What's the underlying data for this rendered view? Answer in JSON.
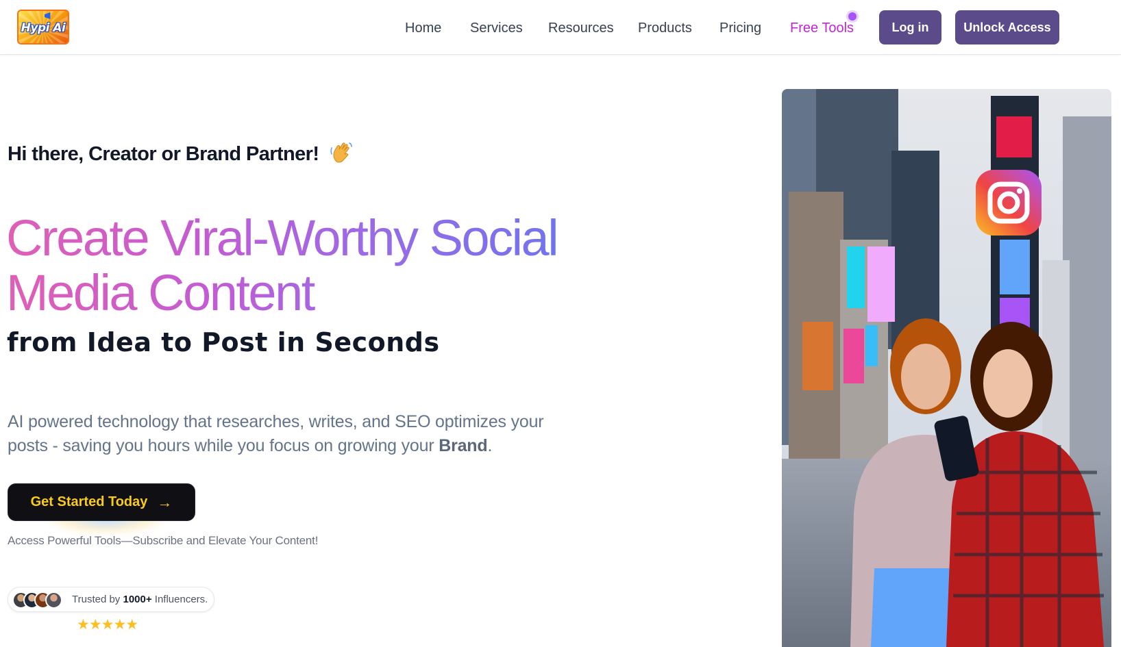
{
  "header": {
    "logo_text": "Hypi Ai",
    "nav": [
      "Home",
      "Services",
      "Resources",
      "Products",
      "Pricing",
      "Free Tools"
    ],
    "login_label": "Log in",
    "unlock_label": "Unlock Access"
  },
  "hero": {
    "greeting": "Hi there, Creator or Brand Partner!",
    "greeting_icon": "waving-hand-icon",
    "headline": "Create Viral-Worthy Social Media Content",
    "subheadline": "from Idea to Post in Seconds",
    "description_before": "AI powered technology that researches, writes, and SEO optimizes your posts - saving you hours while you focus on growing your ",
    "description_bold": "Brand",
    "description_after": ".",
    "cta_label": "Get Started Today",
    "cta_icon": "arrow-right-icon",
    "caption": "Access Powerful Tools—Subscribe and Elevate Your Content!",
    "trust_prefix": "Trusted by ",
    "trust_count": "1000+",
    "trust_suffix": " Influencers.",
    "stars": "★★★★★",
    "rating_stars": 5
  },
  "colors": {
    "brand_purple": "#5b4b8a",
    "free_tools": "#c026d3",
    "cta_bg": "#0f0f14",
    "cta_text": "#facc15",
    "headline_gradient_start": "#e05fb5",
    "headline_gradient_end": "#6f74ee"
  }
}
